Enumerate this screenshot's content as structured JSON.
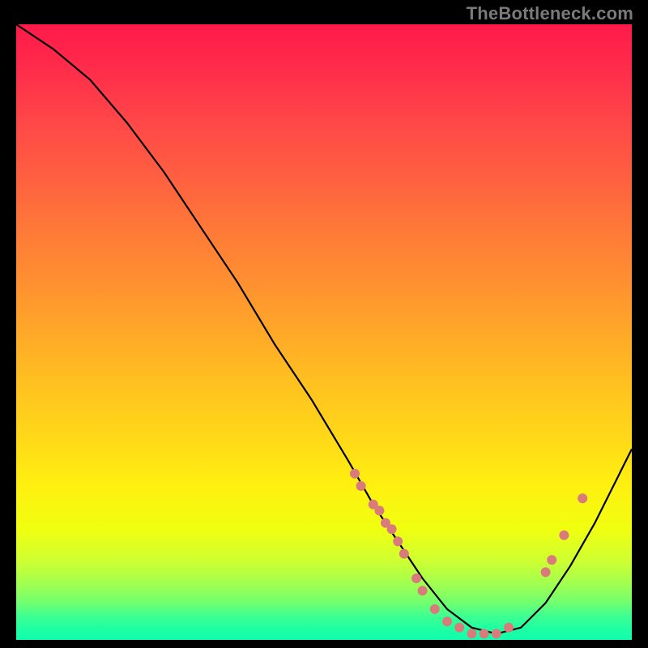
{
  "watermark": "TheBottleneck.com",
  "chart_data": {
    "type": "line",
    "title": "",
    "xlabel": "",
    "ylabel": "",
    "xlim": [
      0,
      100
    ],
    "ylim": [
      0,
      100
    ],
    "grid": false,
    "legend": false,
    "background": "vertical-gradient red→green",
    "curve": {
      "name": "bottleneck-curve",
      "x": [
        0,
        6,
        12,
        18,
        24,
        30,
        36,
        42,
        48,
        54,
        58,
        62,
        66,
        70,
        74,
        78,
        82,
        86,
        90,
        94,
        98,
        100
      ],
      "y": [
        100,
        96,
        91,
        84,
        76,
        67,
        58,
        48,
        39,
        29,
        22,
        16,
        10,
        5,
        2,
        1,
        2,
        6,
        12,
        19,
        27,
        31
      ]
    },
    "markers": [
      {
        "x": 55,
        "y": 27
      },
      {
        "x": 56,
        "y": 25
      },
      {
        "x": 58,
        "y": 22
      },
      {
        "x": 59,
        "y": 21
      },
      {
        "x": 60,
        "y": 19
      },
      {
        "x": 61,
        "y": 18
      },
      {
        "x": 62,
        "y": 16
      },
      {
        "x": 63,
        "y": 14
      },
      {
        "x": 65,
        "y": 10
      },
      {
        "x": 66,
        "y": 8
      },
      {
        "x": 68,
        "y": 5
      },
      {
        "x": 70,
        "y": 3
      },
      {
        "x": 72,
        "y": 2
      },
      {
        "x": 74,
        "y": 1
      },
      {
        "x": 76,
        "y": 1
      },
      {
        "x": 78,
        "y": 1
      },
      {
        "x": 80,
        "y": 2
      },
      {
        "x": 86,
        "y": 11
      },
      {
        "x": 87,
        "y": 13
      },
      {
        "x": 89,
        "y": 17
      },
      {
        "x": 92,
        "y": 23
      }
    ],
    "marker_color": "#d97b7b",
    "curve_color": "#000000"
  }
}
